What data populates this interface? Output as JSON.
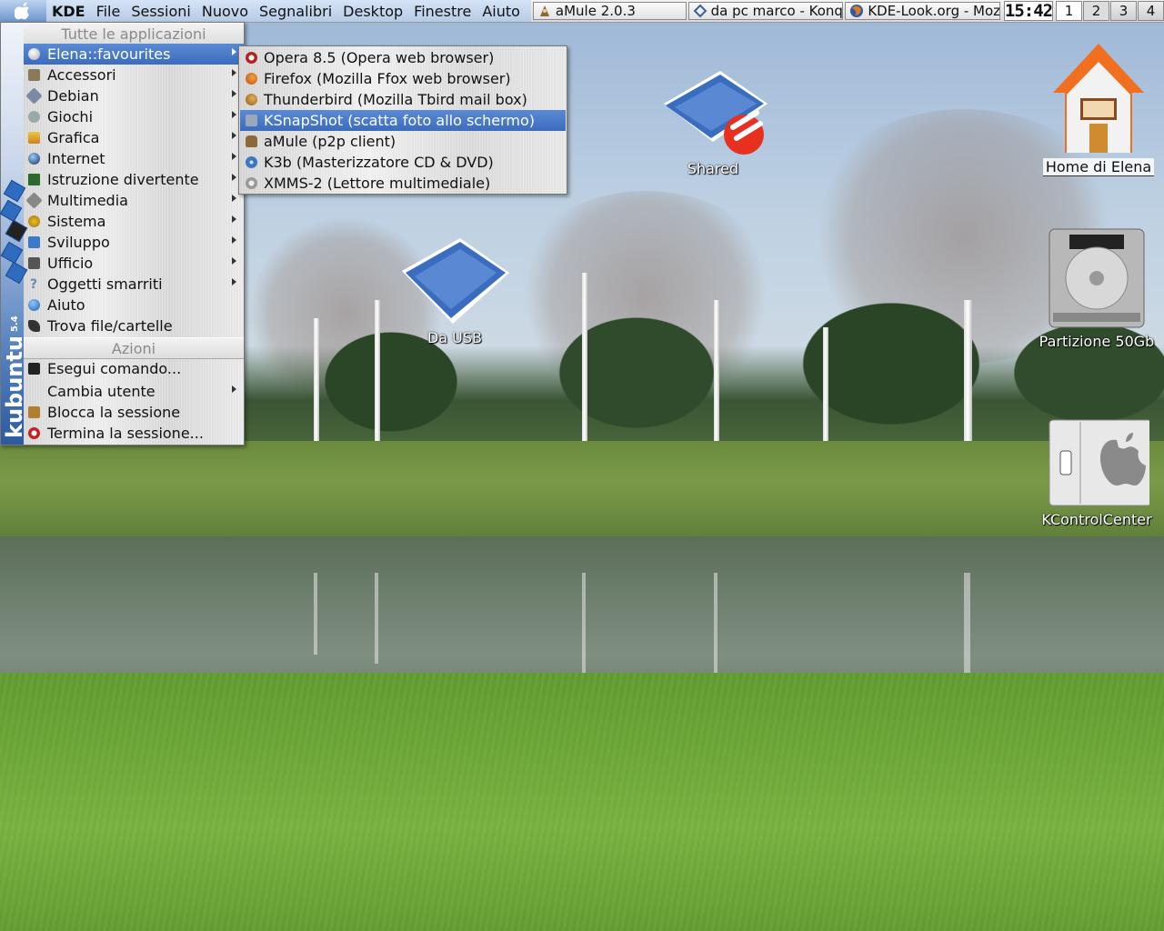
{
  "panel": {
    "menubar": [
      "KDE",
      "File",
      "Sessioni",
      "Nuovo",
      "Segnalibri",
      "Desktop",
      "Finestre",
      "Aiuto"
    ],
    "tasks": [
      {
        "label": "aMule 2.0.3",
        "icon": "amule-icon"
      },
      {
        "label": "da pc marco - Konq",
        "icon": "konqueror-icon"
      },
      {
        "label": "KDE-Look.org - Mozi",
        "icon": "firefox-icon"
      }
    ],
    "clock": "15:42",
    "pager": [
      "1",
      "2",
      "3",
      "4"
    ]
  },
  "kmenu": {
    "section_apps": "Tutte le applicazioni",
    "items": [
      {
        "label": "Elena::favourites",
        "icon": "favourites-icon",
        "submenu": true
      },
      {
        "label": "Accessori",
        "icon": "accessories-icon",
        "submenu": true
      },
      {
        "label": "Debian",
        "icon": "debian-icon",
        "submenu": true
      },
      {
        "label": "Giochi",
        "icon": "games-icon",
        "submenu": true
      },
      {
        "label": "Grafica",
        "icon": "graphics-icon",
        "submenu": true
      },
      {
        "label": "Internet",
        "icon": "internet-icon",
        "submenu": true
      },
      {
        "label": "Istruzione divertente",
        "icon": "education-icon",
        "submenu": true
      },
      {
        "label": "Multimedia",
        "icon": "multimedia-icon",
        "submenu": true
      },
      {
        "label": "Sistema",
        "icon": "system-icon",
        "submenu": true
      },
      {
        "label": "Sviluppo",
        "icon": "development-icon",
        "submenu": true
      },
      {
        "label": "Ufficio",
        "icon": "office-icon",
        "submenu": true
      },
      {
        "label": "Oggetti smarriti",
        "icon": "lost-found-icon",
        "submenu": true
      },
      {
        "label": "Aiuto",
        "icon": "help-icon",
        "submenu": false
      },
      {
        "label": "Trova file/cartelle",
        "icon": "find-icon",
        "submenu": false
      }
    ],
    "section_actions": "Azioni",
    "actions": [
      {
        "label": "Esegui comando...",
        "icon": "run-icon",
        "submenu": false
      },
      {
        "label": "Cambia utente",
        "icon": "switch-user-icon",
        "submenu": true
      },
      {
        "label": "Blocca la sessione",
        "icon": "lock-icon",
        "submenu": false
      },
      {
        "label": "Termina la sessione...",
        "icon": "logout-icon",
        "submenu": false
      }
    ],
    "side_brand": "kubuntu",
    "side_version": "5.4"
  },
  "submenu": {
    "items": [
      {
        "label": "Opera 8.5 (Opera web browser)",
        "icon": "opera-icon",
        "color": "#b22222"
      },
      {
        "label": "Firefox (Mozilla Ffox web browser)",
        "icon": "firefox-icon",
        "color": "#e07a1f"
      },
      {
        "label": "Thunderbird (Mozilla Tbird mail box)",
        "icon": "thunderbird-icon",
        "color": "#c98b2e"
      },
      {
        "label": "KSnapShot (scatta foto allo schermo)",
        "icon": "ksnapshot-icon",
        "color": "#7a8aa0"
      },
      {
        "label": "aMule (p2p client)",
        "icon": "amule-icon",
        "color": "#8a6a3a"
      },
      {
        "label": "K3b (Masterizzatore CD & DVD)",
        "icon": "k3b-icon",
        "color": "#3b78c2"
      },
      {
        "label": "XMMS-2 (Lettore multimediale)",
        "icon": "xmms-icon",
        "color": "#a0a0a0"
      }
    ]
  },
  "desktop": {
    "shared": "Shared",
    "home": "Home di Elena",
    "usb": "Da USB",
    "partition": "Partizione 50Gb",
    "kcontrol": "KControlCenter"
  },
  "colors": {
    "highlight": "#3b6cbe",
    "panel_accent": "#b6cbe6"
  }
}
